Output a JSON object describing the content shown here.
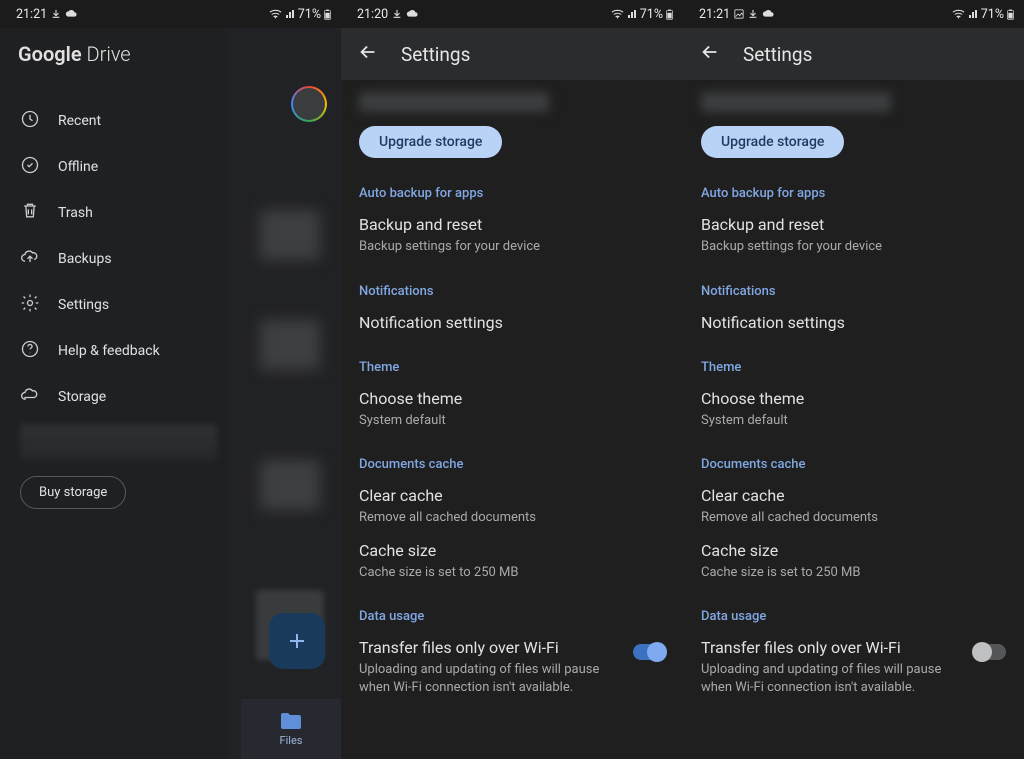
{
  "status": {
    "p1": {
      "time": "21:21",
      "battery": "71%"
    },
    "p2": {
      "time": "21:20",
      "battery": "71%"
    },
    "p3": {
      "time": "21:21",
      "battery": "71%"
    }
  },
  "drawer": {
    "title_bold": "Google",
    "title_thin": " Drive",
    "items": [
      {
        "label": "Recent"
      },
      {
        "label": "Offline"
      },
      {
        "label": "Trash"
      },
      {
        "label": "Backups"
      },
      {
        "label": "Settings"
      },
      {
        "label": "Help & feedback"
      },
      {
        "label": "Storage"
      }
    ],
    "buy_label": "Buy storage",
    "bottom_nav_label": "Files"
  },
  "settings": {
    "header_title": "Settings",
    "upgrade_label": "Upgrade storage",
    "sections": {
      "auto_backup": {
        "label": "Auto backup for apps",
        "item_t": "Backup and reset",
        "item_s": "Backup settings for your device"
      },
      "notifications": {
        "label": "Notifications",
        "item_t": "Notification settings"
      },
      "theme": {
        "label": "Theme",
        "item_t": "Choose theme",
        "item_s": "System default"
      },
      "cache": {
        "label": "Documents cache",
        "clear_t": "Clear cache",
        "clear_s": "Remove all cached documents",
        "size_t": "Cache size",
        "size_s": "Cache size is set to 250 MB"
      },
      "data": {
        "label": "Data usage",
        "wifi_t": "Transfer files only over Wi-Fi",
        "wifi_s": "Uploading and updating of files will pause when Wi-Fi connection isn't available."
      }
    }
  }
}
